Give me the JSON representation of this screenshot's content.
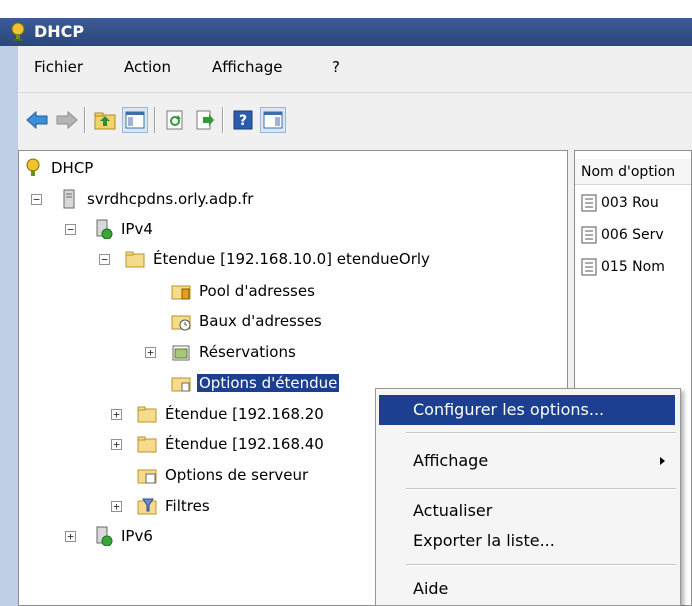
{
  "window": {
    "title": "DHCP"
  },
  "menubar": {
    "items": [
      "Fichier",
      "Action",
      "Affichage",
      "?"
    ]
  },
  "toolbar": {
    "buttons": [
      "back-icon",
      "forward-icon",
      "up-folder-icon",
      "show-tree-icon",
      "refresh-icon",
      "export-icon",
      "help-icon",
      "action-pane-icon"
    ]
  },
  "tree": {
    "root": "DHCP",
    "server": "svrdhcpdns.orly.adp.fr",
    "ipv4": "IPv4",
    "scope1": "Étendue [192.168.10.0] etendueOrly",
    "pool": "Pool d'adresses",
    "leases": "Baux d'adresses",
    "reservations": "Réservations",
    "scope_options": "Options d'étendue",
    "scope2": "Étendue [192.168.20",
    "scope3": "Étendue [192.168.40",
    "server_options": "Options de serveur",
    "filters": "Filtres",
    "ipv6": "IPv6"
  },
  "list": {
    "column_header": "Nom d'option",
    "rows": [
      "003 Rou",
      "006 Serv",
      "015 Nom"
    ]
  },
  "context_menu": {
    "configure": "Configurer les options...",
    "view": "Affichage",
    "refresh": "Actualiser",
    "export": "Exporter la liste...",
    "help": "Aide"
  },
  "colors": {
    "titlebar": "#2b4679",
    "selection": "#1c3f8f",
    "chrome": "#f0f0f0"
  }
}
